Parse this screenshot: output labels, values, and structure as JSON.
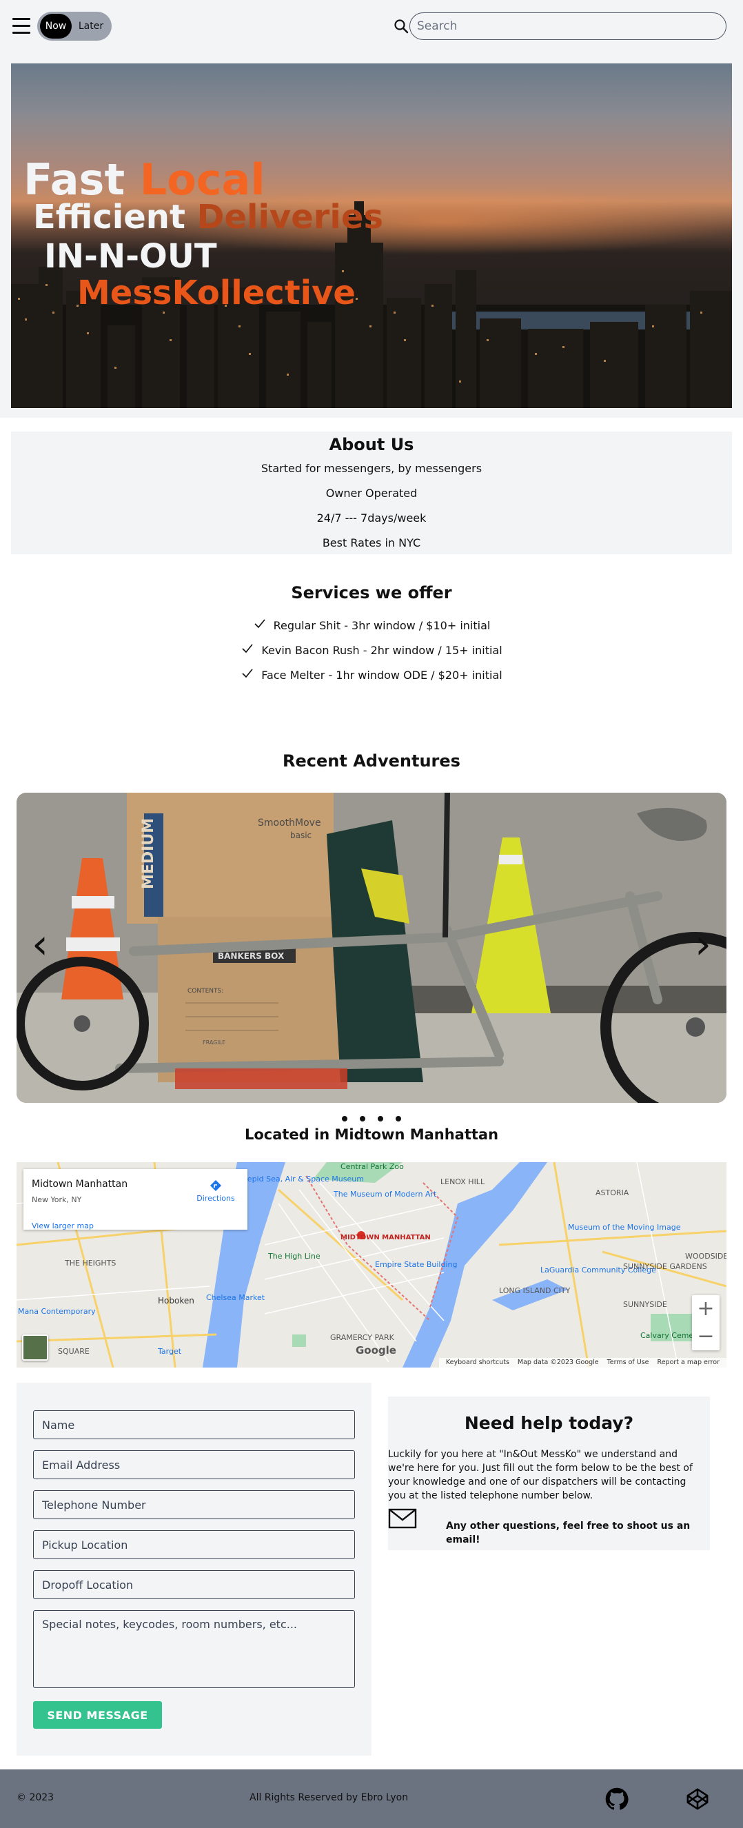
{
  "nav": {
    "toggle": {
      "now_label": "Now",
      "later_label": "Later"
    },
    "search": {
      "placeholder": "Search"
    }
  },
  "hero": {
    "line1_a": "Fast ",
    "line1_b": "Local",
    "line2_a": "Efficient ",
    "line2_b": "Deliveries",
    "line3": "IN-N-OUT",
    "line4": "MessKollective"
  },
  "about": {
    "title": "About Us",
    "lines": [
      "Started for messengers, by messengers",
      "Owner Operated",
      "24/7 --- 7days/week",
      "Best Rates in NYC"
    ]
  },
  "services": {
    "title": "Services we offer",
    "items": [
      "Regular Shit - 3hr window / $10+ initial",
      "Kevin Bacon Rush - 2hr window / 15+ initial",
      "Face Melter - 1hr window ODE / $20+ initial"
    ]
  },
  "adventures": {
    "title": "Recent Adventures",
    "prev_glyph": "‹",
    "next_glyph": "›",
    "slide_text": {
      "box_brand": "SmoothMove",
      "box_sub": "basic",
      "box_size": "MEDIUM",
      "box2": "BANKERS BOX",
      "contents": "CONTENTS:",
      "fragile": "FRAGILE"
    },
    "slide_count": 4
  },
  "location": {
    "title": "Located in Midtown Manhattan",
    "card": {
      "title": "Midtown Manhattan",
      "subtitle": "New York, NY",
      "directions": "Directions",
      "larger_map": "View larger map"
    },
    "map_labels": {
      "central_park_zoo": "Central Park Zoo",
      "intrepid": "Intrepid Sea, Air & Space Museum",
      "moma": "The Museum of Modern Art",
      "lenox_hill": "LENOX HILL",
      "astoria": "ASTORIA",
      "moving_image": "Museum of the Moving Image",
      "midtown": "MIDTOWN MANHATTAN",
      "high_line": "The High Line",
      "empire": "Empire State Building",
      "woodside": "WOODSIDE",
      "heights": "THE HEIGHTS",
      "hoboken": "Hoboken",
      "chelsea": "Chelsea Market",
      "laguardia": "LaGuardia Community College",
      "sunnyside_gardens": "SUNNYSIDE GARDENS",
      "lic": "LONG ISLAND CITY",
      "sunnyside": "SUNNYSIDE",
      "contemporary": "Mana Contemporary",
      "calvary": "Calvary Cemetery",
      "gramercy": "GRAMERCY PARK",
      "square": "SQUARE",
      "target": "Target",
      "google": "Google"
    },
    "zoom_in": "+",
    "zoom_out": "−",
    "footer": [
      "Keyboard shortcuts",
      "Map data ©2023 Google",
      "Terms of Use",
      "Report a map error"
    ]
  },
  "form": {
    "name_placeholder": "Name",
    "email_placeholder": "Email Address",
    "phone_placeholder": "Telephone Number",
    "pickup_placeholder": "Pickup Location",
    "dropoff_placeholder": "Dropoff Location",
    "notes_placeholder": "Special notes, keycodes, room numbers, etc...",
    "submit_label": "SEND MESSAGE"
  },
  "help": {
    "title": "Need help today?",
    "body": "Luckily for you here at \"In&Out MessKo\" we understand and we're here for you. Just fill out the form below to be the best of your knowledge and one of our dispatchers will be contacting you at the listed telephone number below.",
    "email_note": "Any other questions, feel free to shoot us an email!"
  },
  "footer": {
    "copyright": "© 2023",
    "rights": "All Rights Reserved by Ebro Lyon"
  },
  "colors": {
    "accent_orange": "#f26522",
    "button_green": "#34c38f",
    "panel_gray": "#f3f4f6",
    "footer_gray": "#6b7280"
  },
  "icons": {
    "menu": "hamburger-icon",
    "search": "search-icon",
    "check": "check-icon",
    "mail": "mail-icon",
    "github": "github-icon",
    "codepen": "codepen-icon"
  }
}
